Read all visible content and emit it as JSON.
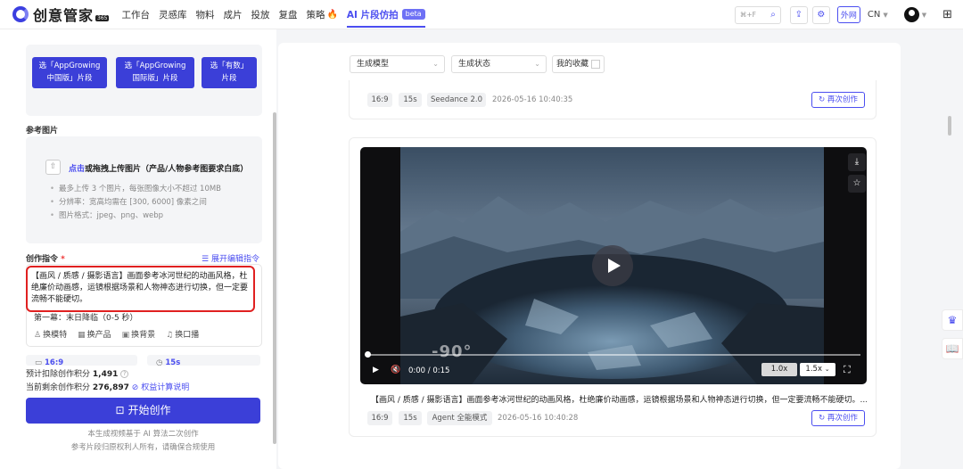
{
  "header": {
    "logo_text": "创意管家",
    "logo_tag": "365",
    "nav": [
      "工作台",
      "灵感库",
      "物料",
      "成片",
      "投放",
      "复盘"
    ],
    "nav_strategy": "策略",
    "nav_active": "AI 片段仿拍",
    "beta_label": "beta",
    "search_shortcut": "⌘+F",
    "waiwang_label": "外网",
    "lang_label": "CN"
  },
  "left": {
    "segment_buttons": [
      "选「AppGrowing\n中国版」片段",
      "选「AppGrowing\n国际版」片段",
      "选「有数」\n片段"
    ],
    "ref_title": "参考图片",
    "upload_link": "点击",
    "upload_text": "或拖拽上传图片（产品/人物参考图要求白底）",
    "upload_rules": [
      "最多上传 3 个图片，每张图像大小不超过 10MB",
      "分辨率：宽高均需在 [300, 6000] 像素之间",
      "图片格式：jpeg、png、webp"
    ],
    "cmd_title": "创作指令",
    "expand_label": "展开编辑指令",
    "cmd_text": "【画风 / 质感 / 摄影语言】画面参考冰河世纪的动画风格，杜绝廉价动画感，运镜根据场景和人物神态进行切换，但一定要流畅不能硬切。",
    "scene_text": "第一幕：末日降临（0-5 秒）",
    "tools": [
      "换模特",
      "换产品",
      "换背景",
      "换口播"
    ],
    "ratio_value": "16:9",
    "duration_value": "15s",
    "estimate_label": "预计扣除创作积分",
    "estimate_value": "1,491",
    "remain_label": "当前剩余创作积分",
    "remain_value": "276,897",
    "rights_link": "权益计算说明",
    "start_label": "开始创作",
    "note1": "本生成视频基于 AI 算法二次创作",
    "note2": "参考片段归原权利人所有，请确保合规使用"
  },
  "filters": {
    "model_label": "生成模型",
    "status_label": "生成状态",
    "fav_label": "我的收藏"
  },
  "cards": [
    {
      "ratio": "16:9",
      "duration": "15s",
      "model": "Seedance 2.0",
      "time": "2026-05-16 10:40:35",
      "recreate": "再次创作"
    },
    {
      "ratio": "16:9",
      "duration": "15s",
      "model": "Agent 全能模式",
      "time": "2026-05-16 10:40:28",
      "recreate": "再次创作",
      "desc": "【画风 / 质感 / 摄影语言】画面参考冰河世纪的动画风格，杜绝廉价动画感，运镜根据场景和人物神态进行切换，但一定要流畅不能硬切。...",
      "watermark": "-90°",
      "time_current": "0:00",
      "time_total": "0:15",
      "speed_1": "1.0x",
      "speed_2": "1.5x"
    }
  ],
  "colors": {
    "accent": "#3b3fd8",
    "highlight_border": "#e02020"
  }
}
